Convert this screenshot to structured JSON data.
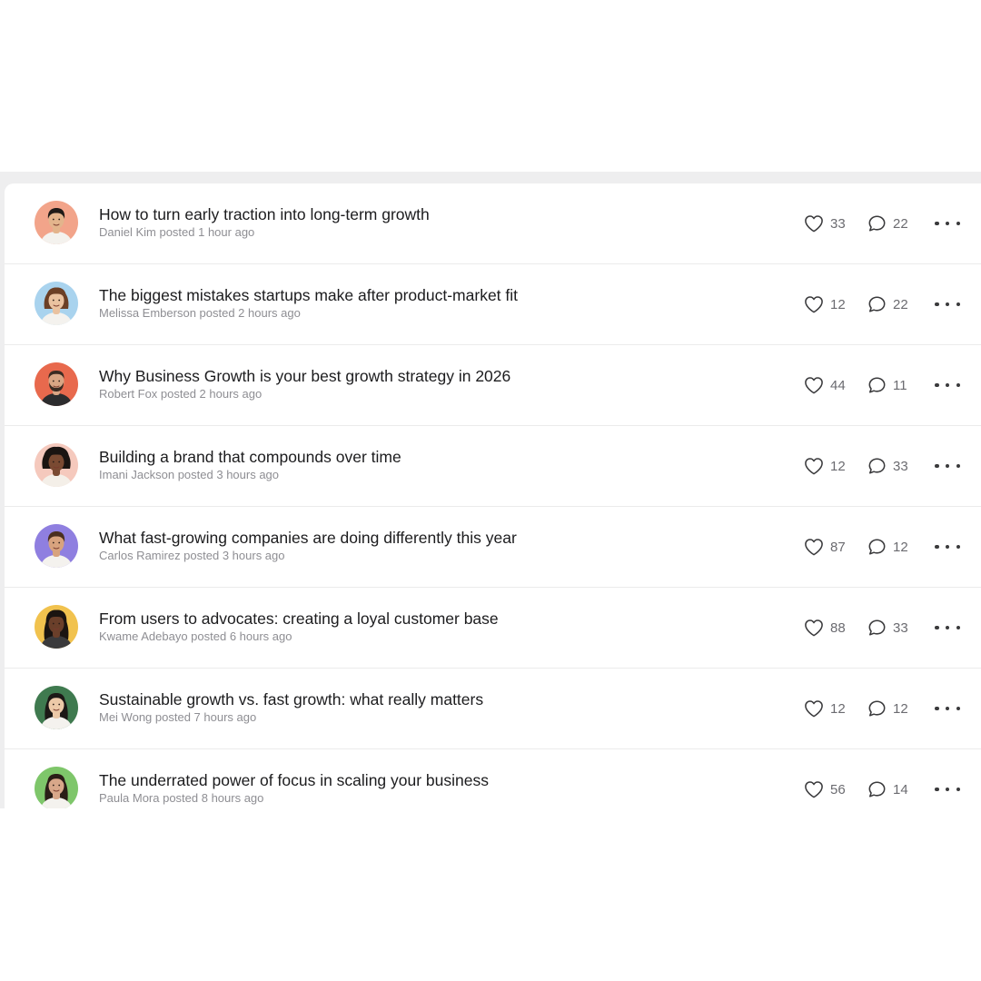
{
  "posts": [
    {
      "title": "How to turn early traction into long-term growth",
      "meta": "Daniel Kim posted 1 hour ago",
      "likes": "33",
      "comments": "22",
      "avatar_bg": "#f2a48a",
      "skin": "#e3b48c",
      "hair": "#1f1a17",
      "shirt": "#f4f2ee",
      "hair_style": "short"
    },
    {
      "title": "The biggest mistakes startups make after product-market fit",
      "meta": "Melissa Emberson posted 2 hours ago",
      "likes": "12",
      "comments": "22",
      "avatar_bg": "#a9d3ee",
      "skin": "#eac2a0",
      "hair": "#6b3f26",
      "shirt": "#f4f2ee",
      "hair_style": "curly"
    },
    {
      "title": "Why Business Growth is your best growth strategy in 2026",
      "meta": "Robert Fox posted 2 hours ago",
      "likes": "44",
      "comments": "11",
      "avatar_bg": "#e8694d",
      "skin": "#d9a584",
      "hair": "#3b2b22",
      "shirt": "#2c2c2e",
      "hair_style": "beard"
    },
    {
      "title": "Building a brand that compounds over time",
      "meta": "Imani Jackson posted 3 hours ago",
      "likes": "12",
      "comments": "33",
      "avatar_bg": "#f5c9bd",
      "skin": "#7a4a32",
      "hair": "#1a1411",
      "shirt": "#f4efe8",
      "hair_style": "afro"
    },
    {
      "title": "What fast-growing companies are doing differently this year",
      "meta": "Carlos Ramirez posted 3 hours ago",
      "likes": "87",
      "comments": "12",
      "avatar_bg": "#8f7fe0",
      "skin": "#d8a37e",
      "hair": "#4a2f1f",
      "shirt": "#f4f2ee",
      "hair_style": "short"
    },
    {
      "title": "From users to advocates: creating a loyal customer base",
      "meta": "Kwame Adebayo posted 6 hours ago",
      "likes": "88",
      "comments": "33",
      "avatar_bg": "#f1c24e",
      "skin": "#6a3f2a",
      "hair": "#1a1411",
      "shirt": "#3a3a3c",
      "hair_style": "locs"
    },
    {
      "title": "Sustainable growth vs. fast growth: what really matters",
      "meta": "Mei Wong posted 7 hours ago",
      "likes": "12",
      "comments": "12",
      "avatar_bg": "#3f7a4f",
      "skin": "#ecc9a8",
      "hair": "#1c1816",
      "shirt": "#f4f2ee",
      "hair_style": "long"
    },
    {
      "title": "The underrated power of focus in scaling your business",
      "meta": "Paula Mora posted 8 hours ago",
      "likes": "56",
      "comments": "14",
      "avatar_bg": "#7ec66a",
      "skin": "#d8a78a",
      "hair": "#2a1d17",
      "shirt": "#f4f2ee",
      "hair_style": "long"
    }
  ],
  "icons": {
    "like": "heart-icon",
    "comment": "comment-icon",
    "more": "more-options-icon"
  },
  "colors": {
    "text_primary": "#1c1c1e",
    "text_secondary": "#8e8e93",
    "icon": "#3a3a3c",
    "divider": "#ebebeb",
    "backdrop": "#eeeeef"
  }
}
